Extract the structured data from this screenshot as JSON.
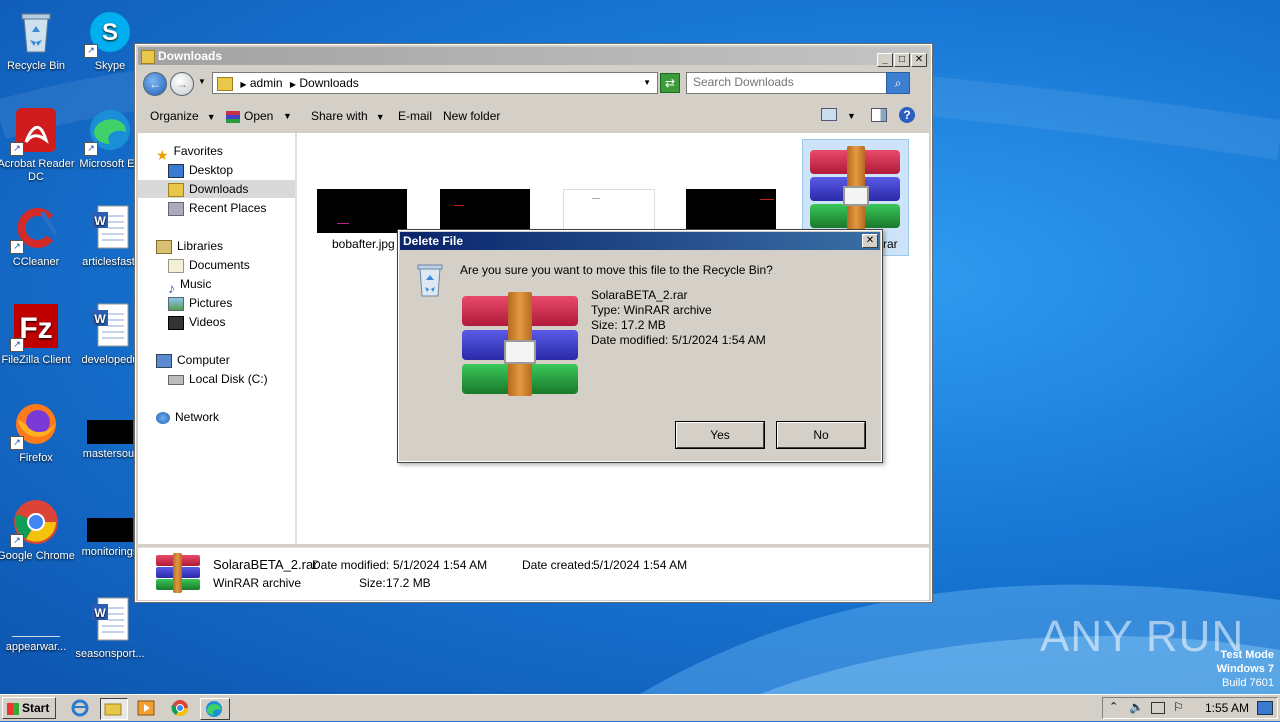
{
  "desktop": {
    "icons": [
      {
        "label": "Recycle Bin"
      },
      {
        "label": "Skype"
      },
      {
        "label": "Acrobat Reader DC"
      },
      {
        "label": "Microsoft Ed"
      },
      {
        "label": "CCleaner"
      },
      {
        "label": "articlesfast."
      },
      {
        "label": "FileZilla Client"
      },
      {
        "label": "developedu"
      },
      {
        "label": "Firefox"
      },
      {
        "label": "mastersout"
      },
      {
        "label": "Google Chrome"
      },
      {
        "label": "monitorings"
      },
      {
        "label": "appearwar..."
      },
      {
        "label": "seasonsport..."
      }
    ],
    "watermark": "ANY RUN",
    "test_mode": {
      "line1": "Test Mode",
      "line2": "Windows 7",
      "line3": "Build 7601"
    }
  },
  "explorer": {
    "title": "Downloads",
    "address": {
      "crumbs": [
        "admin",
        "Downloads"
      ]
    },
    "search": {
      "placeholder": "Search Downloads"
    },
    "toolbar": {
      "organize": "Organize",
      "open": "Open",
      "share_with": "Share with",
      "email": "E-mail",
      "new_folder": "New folder"
    },
    "nav": {
      "favorites": "Favorites",
      "desktop": "Desktop",
      "downloads": "Downloads",
      "recent_places": "Recent Places",
      "libraries": "Libraries",
      "documents": "Documents",
      "music": "Music",
      "pictures": "Pictures",
      "videos": "Videos",
      "computer": "Computer",
      "local_disk": "Local Disk (C:)",
      "network": "Network"
    },
    "files": [
      {
        "name": "bobafter.jpg"
      },
      {
        "name": ""
      },
      {
        "name": ""
      },
      {
        "name": ""
      },
      {
        "name": "rar"
      }
    ],
    "details": {
      "name": "SolaraBETA_2.rar",
      "type": "WinRAR archive",
      "date_modified_label": "Date modified:",
      "date_modified": "5/1/2024 1:54 AM",
      "size_label": "Size:",
      "size": "17.2 MB",
      "date_created_label": "Date created:",
      "date_created": "5/1/2024 1:54 AM"
    }
  },
  "dialog": {
    "title": "Delete File",
    "message": "Are you sure you want to move this file to the Recycle Bin?",
    "file_name": "SolaraBETA_2.rar",
    "file_type": "Type: WinRAR archive",
    "file_size": "Size: 17.2 MB",
    "file_modified": "Date modified: 5/1/2024 1:54 AM",
    "yes": "Yes",
    "no": "No"
  },
  "taskbar": {
    "start": "Start",
    "clock": "1:55 AM"
  }
}
